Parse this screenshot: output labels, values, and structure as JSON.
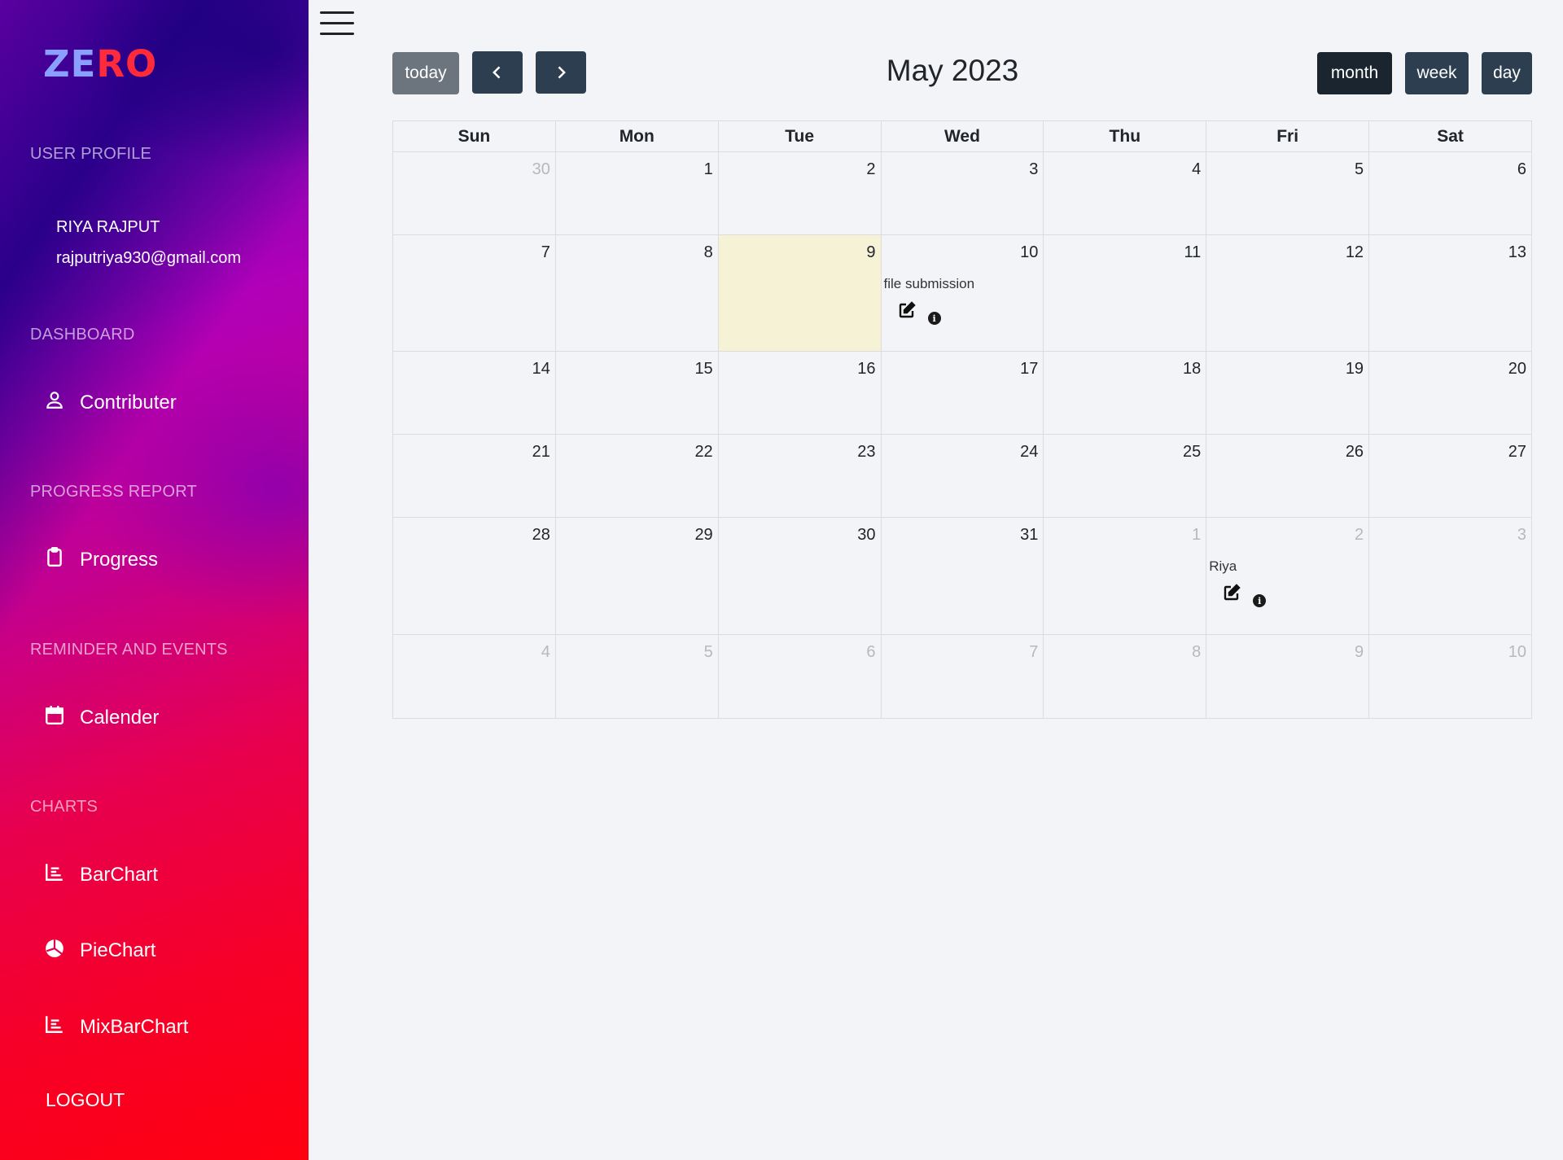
{
  "sidebar": {
    "logo_part1": "ZE",
    "logo_part2": "RO",
    "user_profile_heading": "USER PROFILE",
    "user_name": "RIYA  RAJPUT",
    "user_email": "rajputriya930@gmail.com",
    "dashboard_heading": "DASHBOARD",
    "contributer_label": "Contributer",
    "progress_report_heading": "PROGRESS REPORT",
    "progress_label": "Progress",
    "reminder_heading": "REMINDER AND EVENTS",
    "calender_label": "Calender",
    "charts_heading": "CHARTS",
    "barchart_label": "BarChart",
    "piechart_label": "PieChart",
    "mixbarchart_label": "MixBarChart",
    "logout_label": "LOGOUT"
  },
  "toolbar": {
    "today_label": "today",
    "title": "May 2023",
    "month_label": "month",
    "week_label": "week",
    "day_label": "day"
  },
  "calendar": {
    "weekdays": [
      "Sun",
      "Mon",
      "Tue",
      "Wed",
      "Thu",
      "Fri",
      "Sat"
    ],
    "weeks": [
      [
        "30",
        "1",
        "2",
        "3",
        "4",
        "5",
        "6"
      ],
      [
        "7",
        "8",
        "9",
        "10",
        "11",
        "12",
        "13"
      ],
      [
        "14",
        "15",
        "16",
        "17",
        "18",
        "19",
        "20"
      ],
      [
        "21",
        "22",
        "23",
        "24",
        "25",
        "26",
        "27"
      ],
      [
        "28",
        "29",
        "30",
        "31",
        "1",
        "2",
        "3"
      ],
      [
        "4",
        "5",
        "6",
        "7",
        "8",
        "9",
        "10"
      ]
    ],
    "events": {
      "file_submission": "file submission",
      "riya": "Riya"
    }
  }
}
